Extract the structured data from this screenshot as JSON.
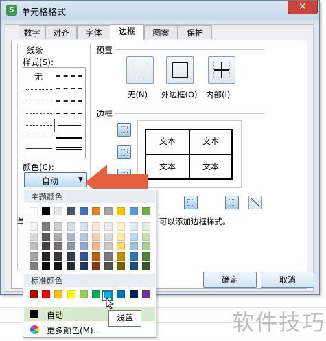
{
  "dialog": {
    "title": "单元格格式",
    "close": "✕"
  },
  "tabs": [
    "数字",
    "对齐",
    "字体",
    "边框",
    "图案",
    "保护"
  ],
  "active_tab": "边框",
  "line": {
    "group_label": "线条",
    "style_label": "样式(S):",
    "none_label": "无",
    "color_label": "颜色(C):",
    "color_value": "自动"
  },
  "preset": {
    "section_label": "预置",
    "none": "无(N)",
    "outline": "外边框(O)",
    "inside": "内部(I)"
  },
  "border": {
    "section_label": "边框",
    "cells": [
      "文本",
      "文本",
      "文本",
      "文本"
    ]
  },
  "hint": {
    "prefix": "单",
    "text": "可以添加边框样式。"
  },
  "buttons": {
    "ok": "确定",
    "cancel": "取消"
  },
  "popup": {
    "theme_label": "主题颜色",
    "standard_label": "标准颜色",
    "auto_label": "自动",
    "more_label": "更多颜色(M)...",
    "theme_top": [
      "#ffffff",
      "#000000",
      "#e7e6e6",
      "#44546a",
      "#4472c4",
      "#ed7d31",
      "#a5a5a5",
      "#ffc000",
      "#5b9bd5",
      "#70ad47"
    ],
    "theme_shades": [
      [
        "#f2f2f2",
        "#7f7f7f",
        "#d0cece",
        "#d6dce5",
        "#d9e2f3",
        "#fbe5d6",
        "#ededed",
        "#fff2cc",
        "#deebf7",
        "#e2f0d9"
      ],
      [
        "#d9d9d9",
        "#595959",
        "#aeabab",
        "#adb9ca",
        "#b4c7e7",
        "#f8cbad",
        "#dbdbdb",
        "#ffe699",
        "#bdd7ee",
        "#c5e0b4"
      ],
      [
        "#bfbfbf",
        "#404040",
        "#757171",
        "#8497b0",
        "#8faadc",
        "#f4b183",
        "#c9c9c9",
        "#ffd966",
        "#9dc3e6",
        "#a9d18e"
      ],
      [
        "#a6a6a6",
        "#262626",
        "#3a3838",
        "#333f50",
        "#2f5597",
        "#c55a11",
        "#7b7b7b",
        "#bf9000",
        "#2e75b6",
        "#548235"
      ],
      [
        "#808080",
        "#0d0d0d",
        "#171616",
        "#222a35",
        "#203864",
        "#843c0c",
        "#525252",
        "#7f6000",
        "#1f4e79",
        "#385723"
      ]
    ],
    "standard": [
      "#c00000",
      "#ff0000",
      "#ffc000",
      "#ffff00",
      "#92d050",
      "#00b050",
      "#00b0f0",
      "#0070c0",
      "#002060",
      "#7030a0"
    ],
    "selected_index": 6,
    "tooltip": "浅蓝"
  },
  "watermark": "软件技巧"
}
